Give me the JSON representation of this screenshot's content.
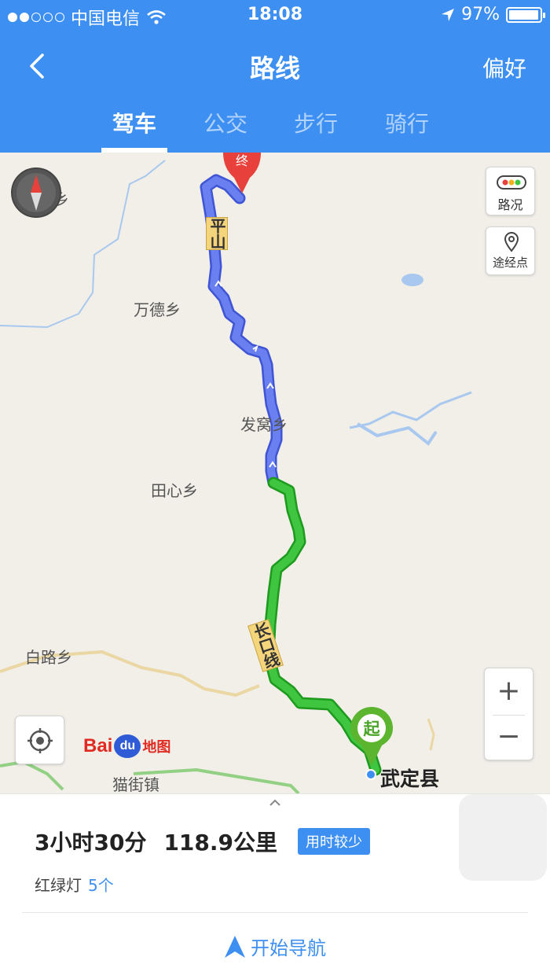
{
  "status_bar": {
    "carrier": "中国电信",
    "time": "18:08",
    "battery": "97%",
    "battery_level": 0.97,
    "signal_bars": 2,
    "signal_total": 5
  },
  "nav": {
    "title": "路线",
    "right_label": "偏好"
  },
  "tabs": [
    {
      "label": "驾车",
      "active": true
    },
    {
      "label": "公交",
      "active": false
    },
    {
      "label": "步行",
      "active": false
    },
    {
      "label": "骑行",
      "active": false
    }
  ],
  "map": {
    "place_labels": [
      "江竹乡",
      "万德乡",
      "发窝乡",
      "田心乡",
      "白路乡",
      "猫街镇",
      "武定县"
    ],
    "road_names": [
      "平山",
      "长口线"
    ],
    "traffic_label": "路况",
    "waypoint_label": "途经点",
    "start_marker": "起",
    "end_marker": "终",
    "zoom_in": "+",
    "zoom_out": "−",
    "logo_text": "Bai",
    "logo_du": "du",
    "logo_map": "地图",
    "icons": [
      "compass-icon",
      "traffic-light-icon",
      "location-pin-icon",
      "my-location-icon"
    ],
    "route_colors": {
      "congested_free": "#5a6ee8",
      "smooth": "#2fb52f"
    }
  },
  "sheet": {
    "duration": "3小时30分",
    "distance": "118.9公里",
    "badge": "用时较少",
    "lights_label": "红绿灯",
    "lights_count": "5个",
    "start_nav": "开始导航"
  },
  "colors": {
    "accent": "#3d8ff2",
    "map_bg": "#f2efe9",
    "river": "#a9c8ef"
  }
}
